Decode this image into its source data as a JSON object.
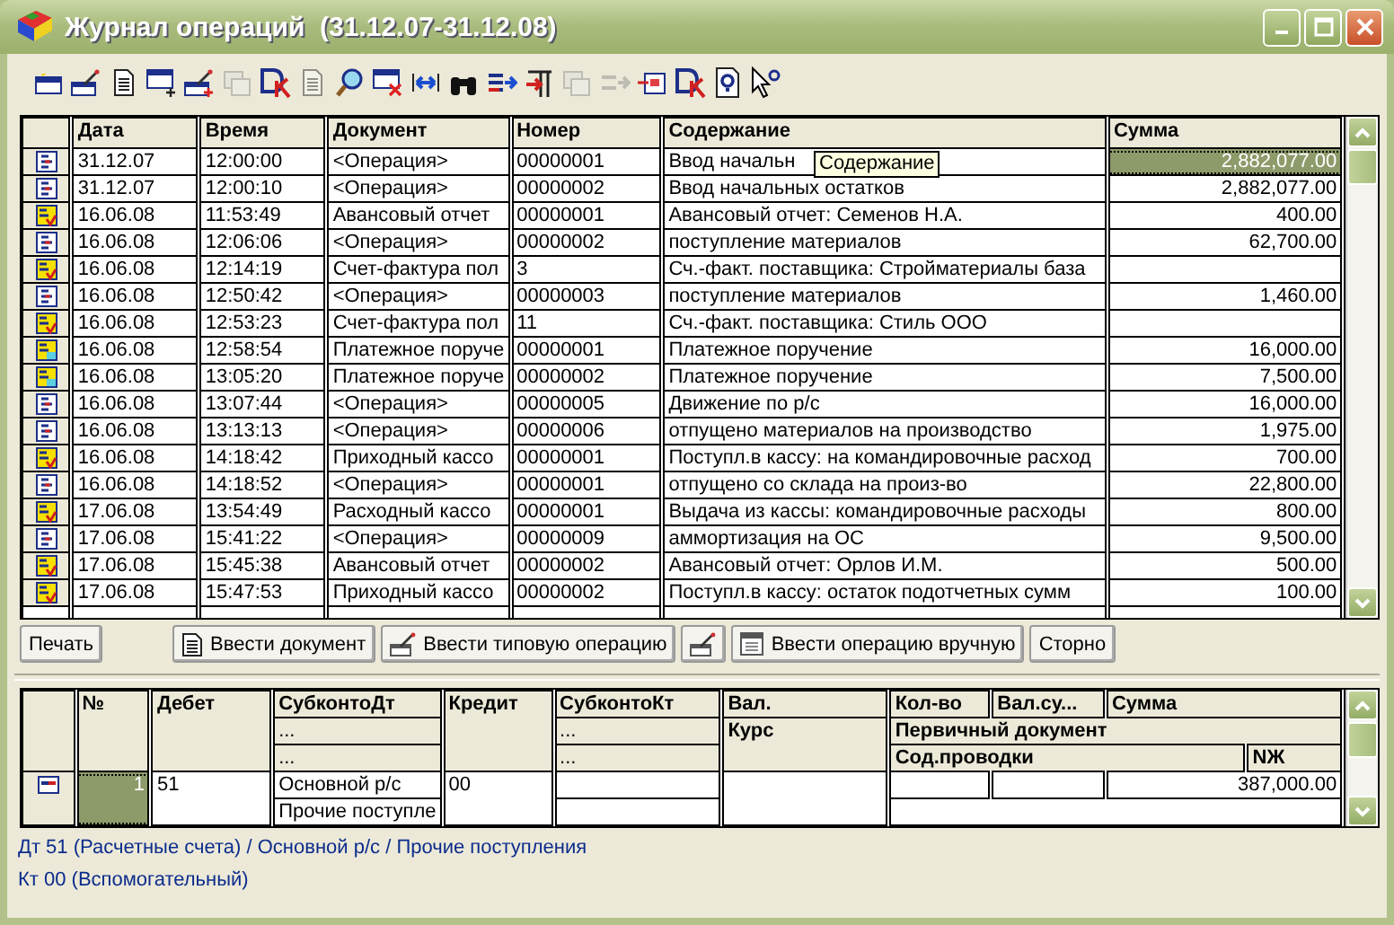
{
  "window": {
    "title": "Журнал операций  (31.12.07-31.12.08)"
  },
  "toolbar": [
    {
      "kind": "table-star",
      "disabled": false
    },
    {
      "kind": "wand",
      "disabled": false
    },
    {
      "kind": "page",
      "disabled": false
    },
    {
      "kind": "table-plus",
      "disabled": false
    },
    {
      "kind": "wand-plus",
      "disabled": false
    },
    {
      "kind": "copy",
      "disabled": true
    },
    {
      "kind": "ledger",
      "disabled": false
    },
    {
      "kind": "edit",
      "disabled": true
    },
    {
      "kind": "search",
      "disabled": false
    },
    {
      "kind": "table-x",
      "disabled": false
    },
    {
      "kind": "double-arrow",
      "disabled": false
    },
    {
      "kind": "binoculars",
      "disabled": false
    },
    {
      "kind": "arrows",
      "disabled": false
    },
    {
      "kind": "column-arrow",
      "disabled": false
    },
    {
      "kind": "windows",
      "disabled": true
    },
    {
      "kind": "arrow",
      "disabled": true
    },
    {
      "kind": "frame",
      "disabled": false
    },
    {
      "kind": "ledger",
      "disabled": false
    },
    {
      "kind": "help",
      "disabled": false
    },
    {
      "kind": "pointer",
      "disabled": false
    }
  ],
  "journal": {
    "columns": [
      "Дата",
      "Время",
      "Документ",
      "Номер",
      "Содержание",
      "Сумма"
    ],
    "tooltip": "Содержание",
    "rows": [
      {
        "kind": "op",
        "selected": true,
        "date": "31.12.07",
        "time": "12:00:00",
        "document": "<Операция>",
        "number": "00000001",
        "content": "Ввод начальн",
        "sum": "2,882,077.00"
      },
      {
        "kind": "op",
        "selected": false,
        "date": "31.12.07",
        "time": "12:00:10",
        "document": "<Операция>",
        "number": "00000002",
        "content": "Ввод начальных остатков",
        "sum": "2,882,077.00"
      },
      {
        "kind": "doc",
        "selected": false,
        "date": "16.06.08",
        "time": "11:53:49",
        "document": "Авансовый отчет",
        "number": "00000001",
        "content": "Авансовый отчет: Семенов Н.А.",
        "sum": "400.00"
      },
      {
        "kind": "op",
        "selected": false,
        "date": "16.06.08",
        "time": "12:06:06",
        "document": "<Операция>",
        "number": "00000002",
        "content": "поступление материалов",
        "sum": "62,700.00"
      },
      {
        "kind": "doc",
        "selected": false,
        "date": "16.06.08",
        "time": "12:14:19",
        "document": "Счет-фактура пол",
        "number": "3",
        "content": "Сч.-факт. поставщика: Стройматериалы база",
        "sum": ""
      },
      {
        "kind": "op",
        "selected": false,
        "date": "16.06.08",
        "time": "12:50:42",
        "document": "<Операция>",
        "number": "00000003",
        "content": "поступление материалов",
        "sum": "1,460.00"
      },
      {
        "kind": "doc",
        "selected": false,
        "date": "16.06.08",
        "time": "12:53:23",
        "document": "Счет-фактура пол",
        "number": "11",
        "content": "Сч.-факт. поставщика: Стиль ООО",
        "sum": ""
      },
      {
        "kind": "pay",
        "selected": false,
        "date": "16.06.08",
        "time": "12:58:54",
        "document": "Платежное поруче",
        "number": "00000001",
        "content": "Платежное поручение",
        "sum": "16,000.00"
      },
      {
        "kind": "pay",
        "selected": false,
        "date": "16.06.08",
        "time": "13:05:20",
        "document": "Платежное поруче",
        "number": "00000002",
        "content": "Платежное поручение",
        "sum": "7,500.00"
      },
      {
        "kind": "op",
        "selected": false,
        "date": "16.06.08",
        "time": "13:07:44",
        "document": "<Операция>",
        "number": "00000005",
        "content": "Движение по р/с",
        "sum": "16,000.00"
      },
      {
        "kind": "op",
        "selected": false,
        "date": "16.06.08",
        "time": "13:13:13",
        "document": "<Операция>",
        "number": "00000006",
        "content": "отпущено материалов на производство",
        "sum": "1,975.00"
      },
      {
        "kind": "doc",
        "selected": false,
        "date": "16.06.08",
        "time": "14:18:42",
        "document": "Приходный кассо",
        "number": "00000001",
        "content": "Поступл.в кассу: на командировочные расход",
        "sum": "700.00"
      },
      {
        "kind": "op",
        "selected": false,
        "date": "16.06.08",
        "time": "14:18:52",
        "document": "<Операция>",
        "number": "00000001",
        "content": "отпущено со склада на произ-во",
        "sum": "22,800.00"
      },
      {
        "kind": "doc",
        "selected": false,
        "date": "17.06.08",
        "time": "13:54:49",
        "document": "Расходный кассо",
        "number": "00000001",
        "content": "Выдача из кассы: командировочные расходы",
        "sum": "800.00"
      },
      {
        "kind": "op",
        "selected": false,
        "date": "17.06.08",
        "time": "15:41:22",
        "document": "<Операция>",
        "number": "00000009",
        "content": "аммортизация на ОС",
        "sum": "9,500.00"
      },
      {
        "kind": "doc",
        "selected": false,
        "date": "17.06.08",
        "time": "15:45:38",
        "document": "Авансовый отчет",
        "number": "00000002",
        "content": "Авансовый отчет: Орлов И.М.",
        "sum": "500.00"
      },
      {
        "kind": "doc",
        "selected": false,
        "date": "17.06.08",
        "time": "15:47:53",
        "document": "Приходный кассо",
        "number": "00000002",
        "content": "Поступл.в кассу: остаток подотчетных сумм",
        "sum": "100.00"
      }
    ]
  },
  "buttons": [
    {
      "kind": "text",
      "label": "Печать"
    },
    {
      "kind": "page",
      "label": "Ввести документ"
    },
    {
      "kind": "wand",
      "label": "Ввести типовую операцию"
    },
    {
      "kind": "wand-only"
    },
    {
      "kind": "table",
      "label": "Ввести операцию вручную"
    },
    {
      "kind": "text",
      "label": "Сторно"
    }
  ],
  "entries": {
    "headers": {
      "number": "№",
      "debit": "Дебет",
      "subconto_dt": [
        "СубконтоДт",
        "...",
        "..."
      ],
      "credit": "Кредит",
      "subconto_kt": [
        "СубконтоКт",
        "...",
        "..."
      ],
      "currency": "Вал.",
      "rate": "Курс",
      "quantity": "Кол-во",
      "currency_sum": "Вал.су...",
      "sum": "Сумма",
      "primary_document": "Первичный документ",
      "entry_content": "Сод.проводки",
      "journal_no": "NЖ"
    },
    "rows": [
      {
        "kind": "op",
        "selected": true,
        "number": "1",
        "debit": "51",
        "subconto_dt": [
          "Основной р/с",
          "Прочие поступле"
        ],
        "credit": "00",
        "sum": "387,000.00"
      }
    ]
  },
  "status_lines": [
    "Дт 51 (Расчетные счета) / Основной р/с / Прочие поступления",
    "Кт 00 (Вспомогательный)"
  ]
}
